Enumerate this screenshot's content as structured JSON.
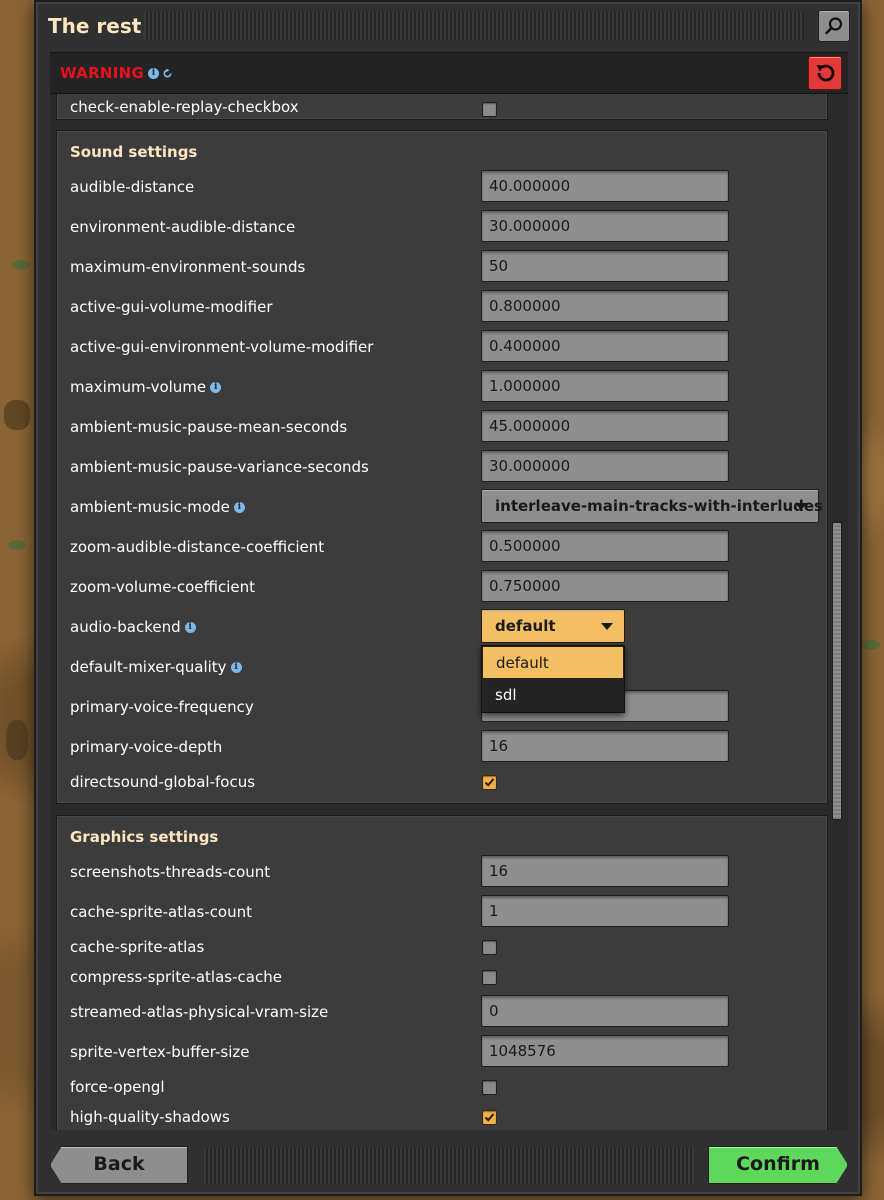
{
  "window": {
    "title": "The rest",
    "warning_label": "WARNING",
    "back_label": "Back",
    "confirm_label": "Confirm"
  },
  "partial_row": {
    "label": "check-enable-replay-checkbox"
  },
  "sound": {
    "title": "Sound settings",
    "rows": [
      {
        "label": "audible-distance",
        "value": "40.000000"
      },
      {
        "label": "environment-audible-distance",
        "value": "30.000000"
      },
      {
        "label": "maximum-environment-sounds",
        "value": "50"
      },
      {
        "label": "active-gui-volume-modifier",
        "value": "0.800000"
      },
      {
        "label": "active-gui-environment-volume-modifier",
        "value": "0.400000"
      },
      {
        "label": "maximum-volume",
        "value": "1.000000"
      },
      {
        "label": "ambient-music-pause-mean-seconds",
        "value": "45.000000"
      },
      {
        "label": "ambient-music-pause-variance-seconds",
        "value": "30.000000"
      },
      {
        "label": "ambient-music-mode",
        "value": "interleave-main-tracks-with-interludes"
      },
      {
        "label": "zoom-audible-distance-coefficient",
        "value": "0.500000"
      },
      {
        "label": "zoom-volume-coefficient",
        "value": "0.750000"
      },
      {
        "label": "audio-backend",
        "value": "default"
      },
      {
        "label": "default-mixer-quality",
        "value": ""
      },
      {
        "label": "primary-voice-frequency",
        "value": ""
      },
      {
        "label": "primary-voice-depth",
        "value": "16"
      },
      {
        "label": "directsound-global-focus",
        "value": ""
      }
    ],
    "audio_backend_options": [
      "default",
      "sdl"
    ]
  },
  "graphics": {
    "title": "Graphics settings",
    "rows": [
      {
        "label": "screenshots-threads-count",
        "value": "16"
      },
      {
        "label": "cache-sprite-atlas-count",
        "value": "1"
      },
      {
        "label": "cache-sprite-atlas",
        "value": ""
      },
      {
        "label": "compress-sprite-atlas-cache",
        "value": ""
      },
      {
        "label": "streamed-atlas-physical-vram-size",
        "value": "0"
      },
      {
        "label": "sprite-vertex-buffer-size",
        "value": "1048576"
      },
      {
        "label": "force-opengl",
        "value": ""
      },
      {
        "label": "high-quality-shadows",
        "value": ""
      }
    ]
  },
  "colors": {
    "accent": "#f2c063",
    "warning": "#e8111b",
    "confirm": "#5ed75a",
    "reset": "#e23a3a",
    "title": "#ffe6c0"
  }
}
